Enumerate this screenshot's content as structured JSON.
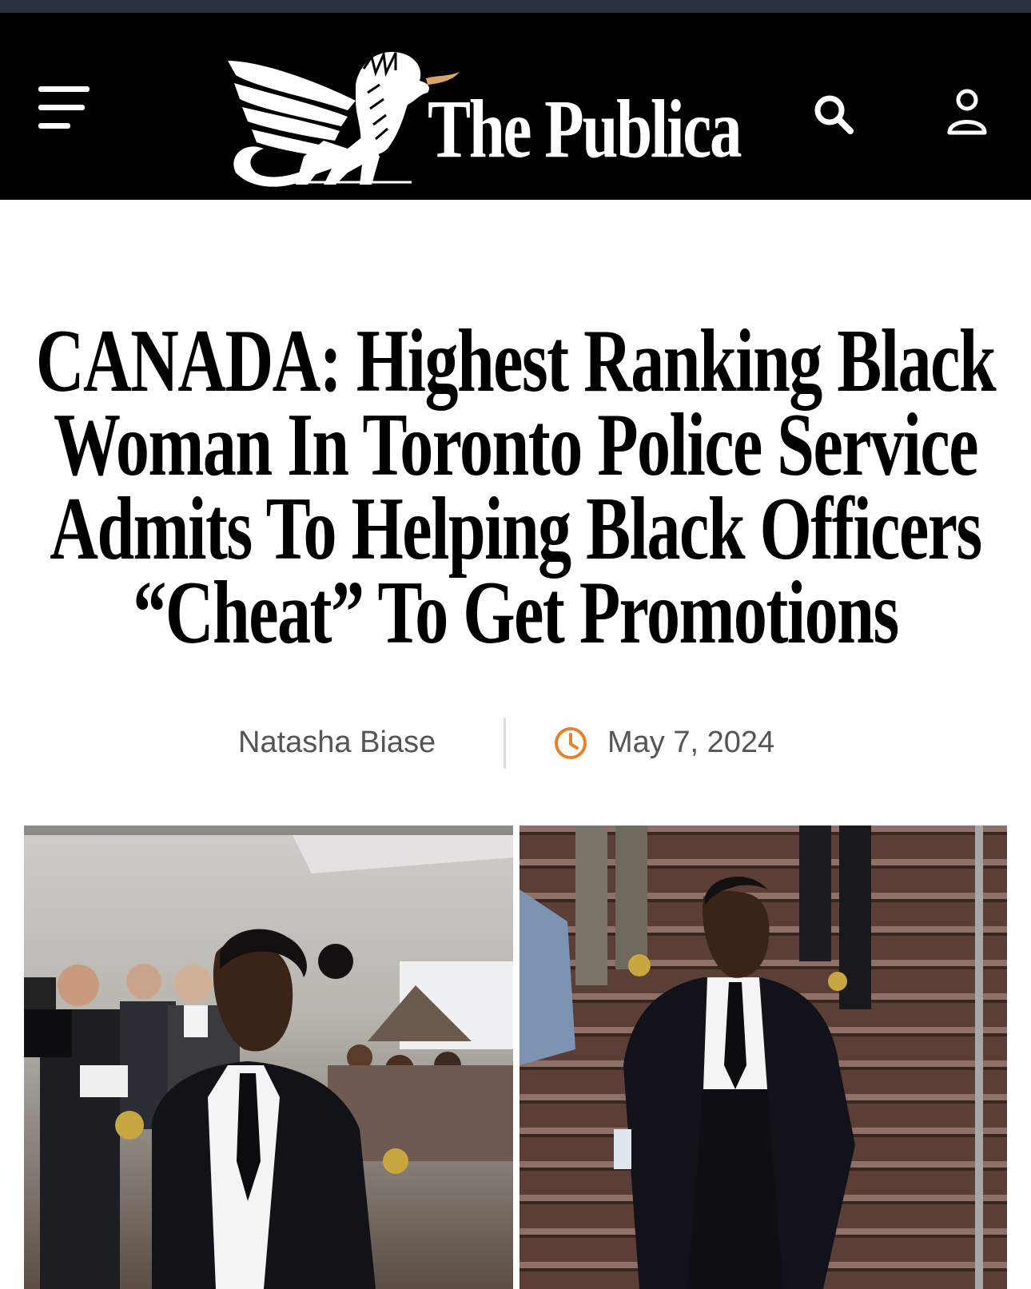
{
  "header": {
    "site_name": "The Publica",
    "menu_icon": "hamburger-menu-icon",
    "search_icon": "search-icon",
    "account_icon": "user-icon",
    "logo_icon": "winged-lion-icon",
    "background_color": "#000000"
  },
  "article": {
    "title": "CANADA: Highest Ranking Black Woman In Toronto Police Service Admits To Helping Black Officers “Cheat” To Get Promotions",
    "author": "Natasha Biase",
    "date": "May 7, 2024",
    "date_icon": "clock-icon",
    "accent_color": "#e8822a"
  },
  "images": [
    {
      "name": "article-photo-left"
    },
    {
      "name": "article-photo-right"
    }
  ]
}
